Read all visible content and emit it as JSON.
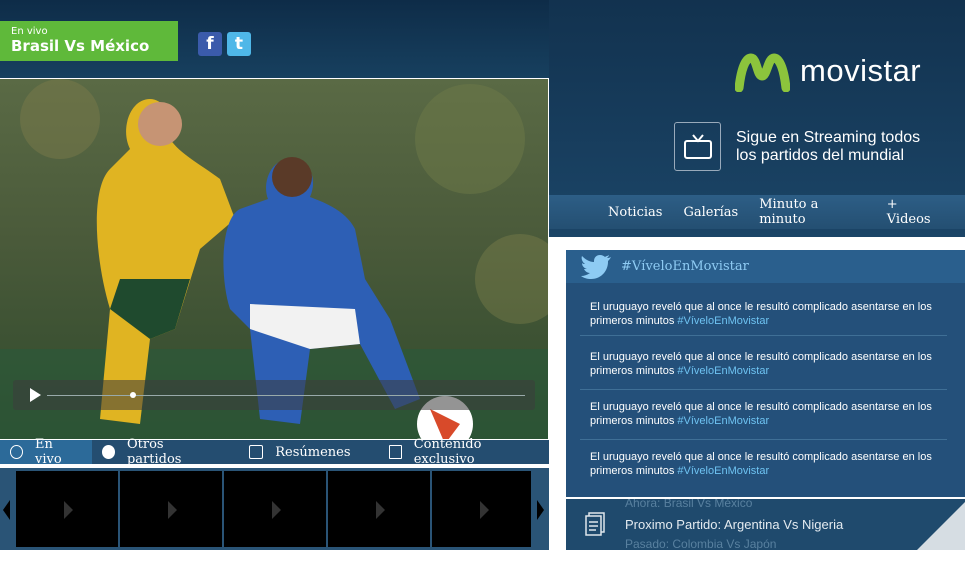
{
  "header": {
    "live_label": "En vivo",
    "match_title": "Brasil Vs México",
    "social": [
      {
        "icon": "facebook-icon",
        "glyph": "f"
      },
      {
        "icon": "twitter-icon",
        "glyph": "t"
      }
    ]
  },
  "brand": {
    "name": "movistar",
    "color": "#8cc43c"
  },
  "promo": {
    "line1": "Sigue en Streaming todos",
    "line2": "los partidos del mundial"
  },
  "nav": {
    "items": [
      "Noticias",
      "Galerías",
      "Minuto a minuto",
      "+ Videos"
    ]
  },
  "video": {
    "progress": 0.18
  },
  "tabs": [
    "En vivo",
    "Otros partidos",
    "Resúmenes",
    "Contenido exclusivo"
  ],
  "twitter": {
    "hashtag": "#VíveloEnMovistar",
    "tweets": [
      {
        "text": "El uruguayo reveló que al once le resultó complicado asentarse en los primeros minutos",
        "tag": "#VíveloEnMovistar"
      },
      {
        "text": "El uruguayo reveló que al once le resultó complicado asentarse en los primeros minutos",
        "tag": "#VíveloEnMovistar"
      },
      {
        "text": "El uruguayo reveló que al once le resultó complicado asentarse en los primeros minutos",
        "tag": "#VíveloEnMovistar"
      },
      {
        "text": "El uruguayo reveló que al once le resultó complicado asentarse en los primeros minutos",
        "tag": "#VíveloEnMovistar"
      }
    ]
  },
  "matches": {
    "prev": "Ahora:  Brasil  Vs  México",
    "current": "Proximo Partido:  Argentina  Vs  Nigeria",
    "next": "Pasado:  Colombia  Vs  Japón"
  },
  "colors": {
    "accent": "#5fb93a",
    "twitter": "#6ec3f2",
    "facebook": "#3b5bab"
  }
}
